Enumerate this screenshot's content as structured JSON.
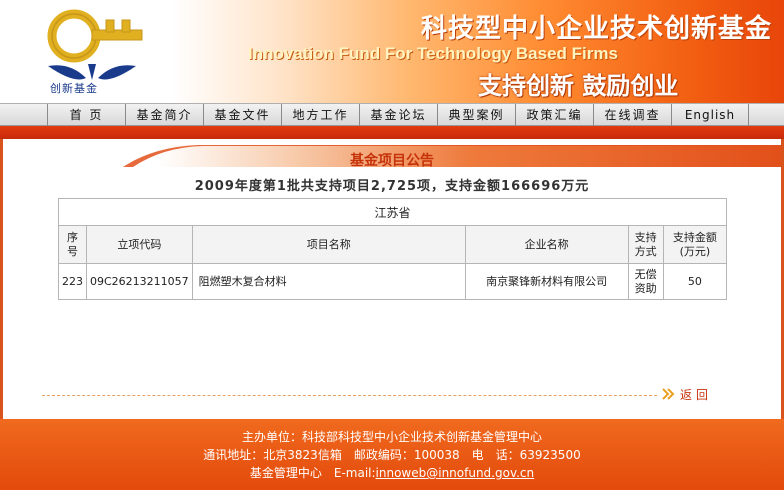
{
  "header": {
    "logo_text": "创新基金",
    "title_cn": "科技型中小企业技术创新基金",
    "title_en": "Innovation Fund For Technology Based Firms",
    "slogan": "支持创新 鼓励创业"
  },
  "nav": {
    "items": [
      {
        "label": "首 页"
      },
      {
        "label": "基金简介"
      },
      {
        "label": "基金文件"
      },
      {
        "label": "地方工作"
      },
      {
        "label": "基金论坛"
      },
      {
        "label": "典型案例"
      },
      {
        "label": "政策汇编"
      },
      {
        "label": "在线调查"
      },
      {
        "label": "English"
      }
    ]
  },
  "notice": {
    "title": "基金项目公告",
    "subtitle": "2009年度第1批共支持项目2,725项，支持金额166696万元"
  },
  "table": {
    "province": "江苏省",
    "headers": {
      "seq": "序号",
      "code": "立项代码",
      "project": "项目名称",
      "company": "企业名称",
      "mode": "支持方式",
      "amount": "支持金额(万元)"
    },
    "rows": [
      {
        "seq": "223",
        "code": "09C26213211057",
        "project": "阻燃塑木复合材料",
        "company": "南京聚锋新材料有限公司",
        "mode": "无偿资助",
        "amount": "50"
      }
    ]
  },
  "back": {
    "label": "返回"
  },
  "footer": {
    "line1": "主办单位：科技部科技型中小企业技术创新基金管理中心",
    "line2": "通讯地址：北京3823信箱　邮政编码：100038　电　话：63923500",
    "line3_prefix": "基金管理中心　E-mail:",
    "email": "innoweb@innofund.gov.cn"
  },
  "colors": {
    "accent": "#e34a0c",
    "title_red": "#c6330a",
    "logo_blue": "#1a3a8c",
    "logo_gold": "#e0b020"
  }
}
